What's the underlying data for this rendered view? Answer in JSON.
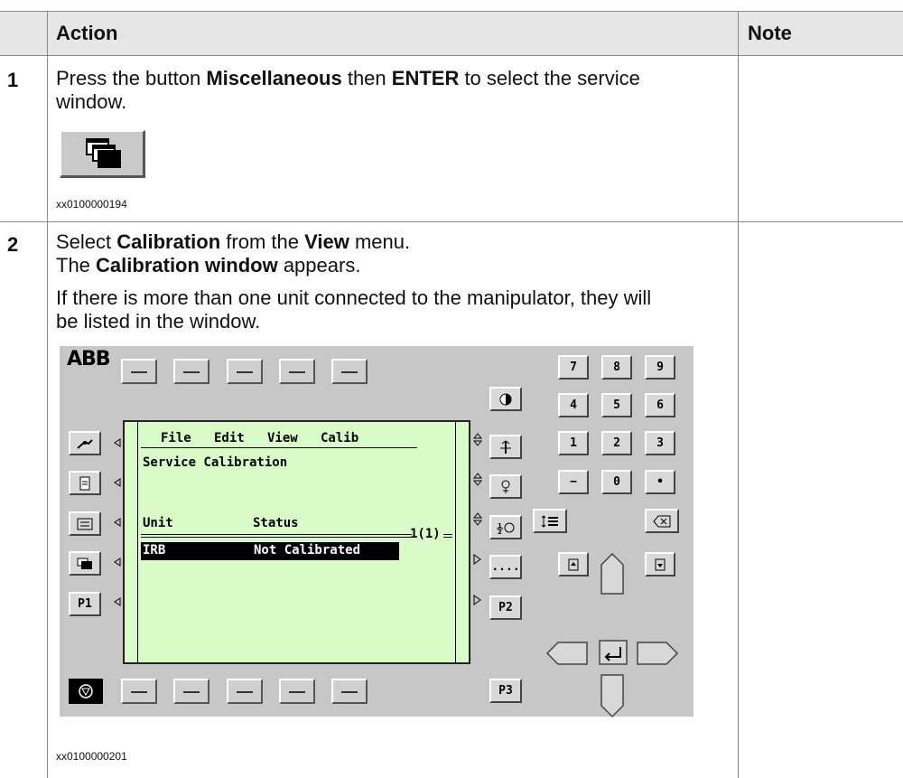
{
  "table": {
    "headers": {
      "action": "Action",
      "note": "Note"
    },
    "rows": [
      {
        "num": "1",
        "text_a": "Press the button ",
        "bold_a": "Miscellaneous",
        "text_b": " then ",
        "bold_b": "ENTER",
        "text_c": " to select the service",
        "text_d": "window.",
        "caption": "xx0100000194",
        "note": ""
      },
      {
        "num": "2",
        "l1_a": "Select ",
        "l1_b": "Calibration",
        "l1_c": " from the ",
        "l1_d": "View",
        "l1_e": " menu.",
        "l2_a": "The ",
        "l2_b": "Calibration window",
        "l2_c": " appears.",
        "l3": "If there is more than one unit connected to the manipulator, they will",
        "l4": "be listed in the window.",
        "caption": "xx0100000201",
        "note": ""
      }
    ]
  },
  "pendant": {
    "logo": "ABB",
    "menu": "File   Edit   View   Calib",
    "window_title": "Service Calibration",
    "col_unit": "Unit",
    "col_status": "Status",
    "counter": "1(1)",
    "row_unit": "IRB",
    "row_status": "Not Calibrated",
    "left_keys": [
      "P1"
    ],
    "right_keys": [
      "....",
      "P2",
      "P3"
    ],
    "numpad": [
      "7",
      "8",
      "9",
      "4",
      "5",
      "6",
      "1",
      "2",
      "3",
      "−",
      "0",
      "•"
    ]
  }
}
